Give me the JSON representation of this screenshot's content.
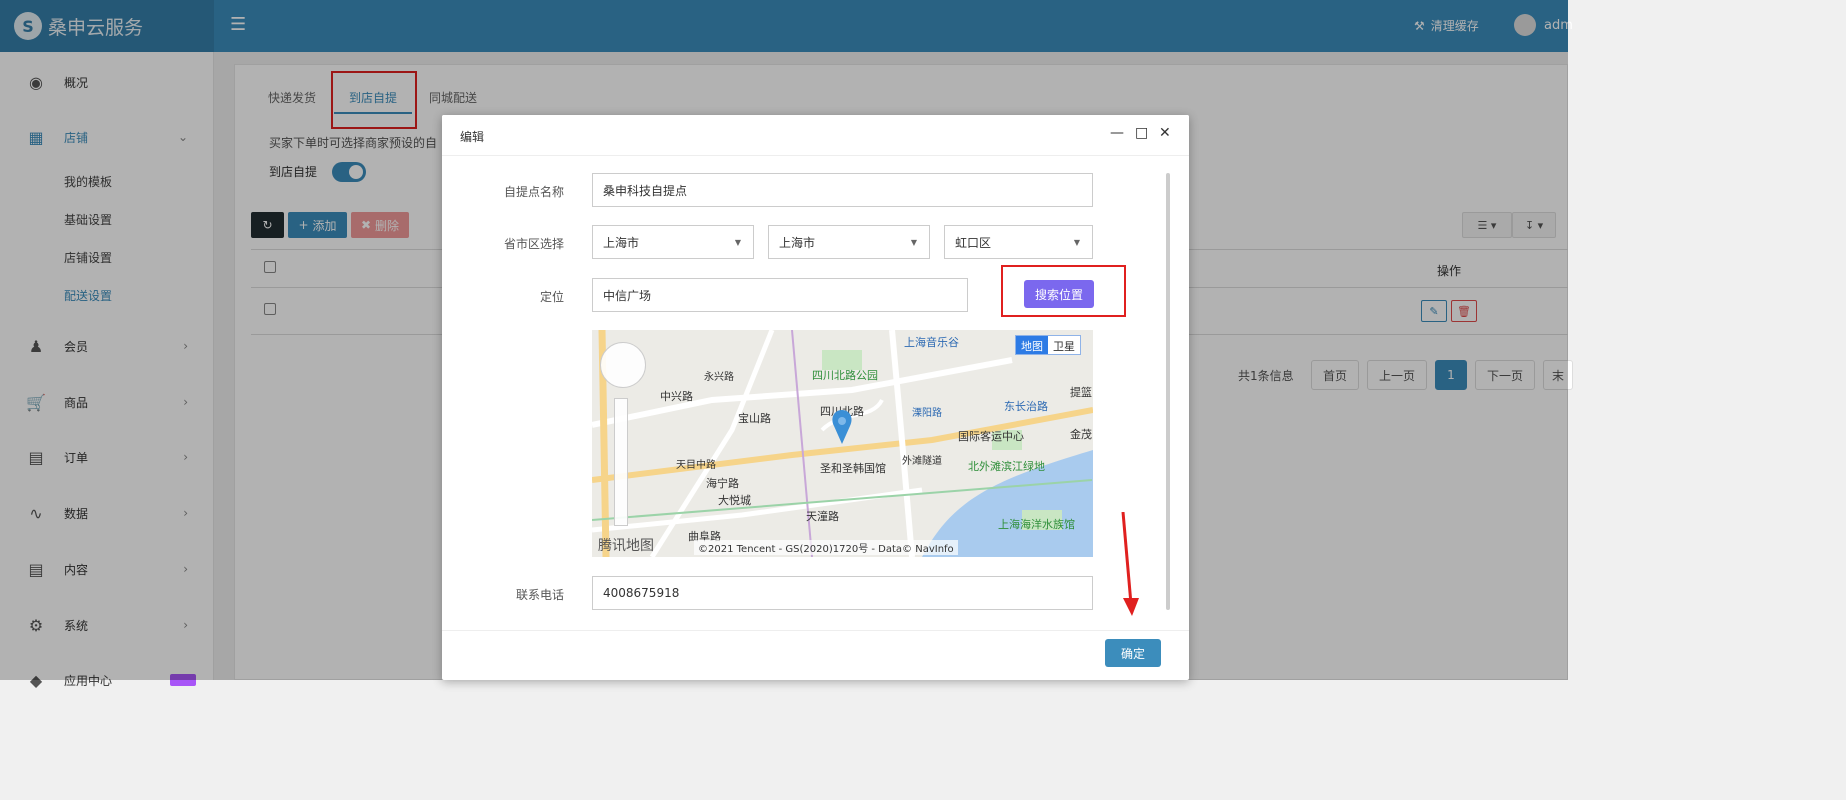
{
  "app": {
    "name": "桑申云服务",
    "logo_letter": "S"
  },
  "topbar": {
    "cache_label": "清理缓存",
    "user": "adm"
  },
  "sidebar": {
    "items": [
      {
        "label": "概况",
        "icon": "dashboard-icon"
      },
      {
        "label": "店铺",
        "icon": "grid-icon",
        "sub": [
          "我的模板",
          "基础设置",
          "店铺设置",
          "配送设置"
        ]
      },
      {
        "label": "会员",
        "icon": "users-icon"
      },
      {
        "label": "商品",
        "icon": "cart-icon"
      },
      {
        "label": "订单",
        "icon": "money-icon"
      },
      {
        "label": "数据",
        "icon": "chart-icon"
      },
      {
        "label": "内容",
        "icon": "document-icon"
      },
      {
        "label": "系统",
        "icon": "gear-icon"
      },
      {
        "label": "应用中心",
        "icon": "app-icon"
      }
    ]
  },
  "tabs": [
    "快递发货",
    "到店自提",
    "同城配送"
  ],
  "page": {
    "description": "买家下单时可选择商家预设的自",
    "switch_label": "到店自提",
    "toolbar": {
      "add": "添加",
      "delete": "删除"
    },
    "table": {
      "op_header": "操作"
    },
    "pager": {
      "info": "共1条信息",
      "first": "首页",
      "prev": "上一页",
      "current": "1",
      "next": "下一页",
      "last": "末"
    }
  },
  "modal": {
    "title": "编辑",
    "fields": {
      "name_label": "自提点名称",
      "name_value": "桑申科技自提点",
      "region_label": "省市区选择",
      "province": "上海市",
      "city": "上海市",
      "district": "虹口区",
      "location_label": "定位",
      "location_value": "中信广场",
      "search_button": "搜索位置",
      "phone_label": "联系电话",
      "phone_value": "4008675918"
    },
    "map": {
      "type_map": "地图",
      "type_satellite": "卫星",
      "logo": "腾讯地图",
      "copyright": "©2021 Tencent - GS(2020)1720号 - Data© NavInfo",
      "labels": [
        "上海音乐谷",
        "四川北路公园",
        "中兴路",
        "宝山路",
        "四川北路",
        "国际客运中心",
        "东长治路",
        "金茂",
        "北外滩滨江绿地",
        "圣和圣韩国馆",
        "海宁路",
        "大悦城",
        "天潼路",
        "曲阜路",
        "上海海洋水族馆",
        "天目中路",
        "永兴路",
        "外滩隧道",
        "溧阳路",
        "提篮"
      ]
    },
    "ok_button": "确定"
  }
}
